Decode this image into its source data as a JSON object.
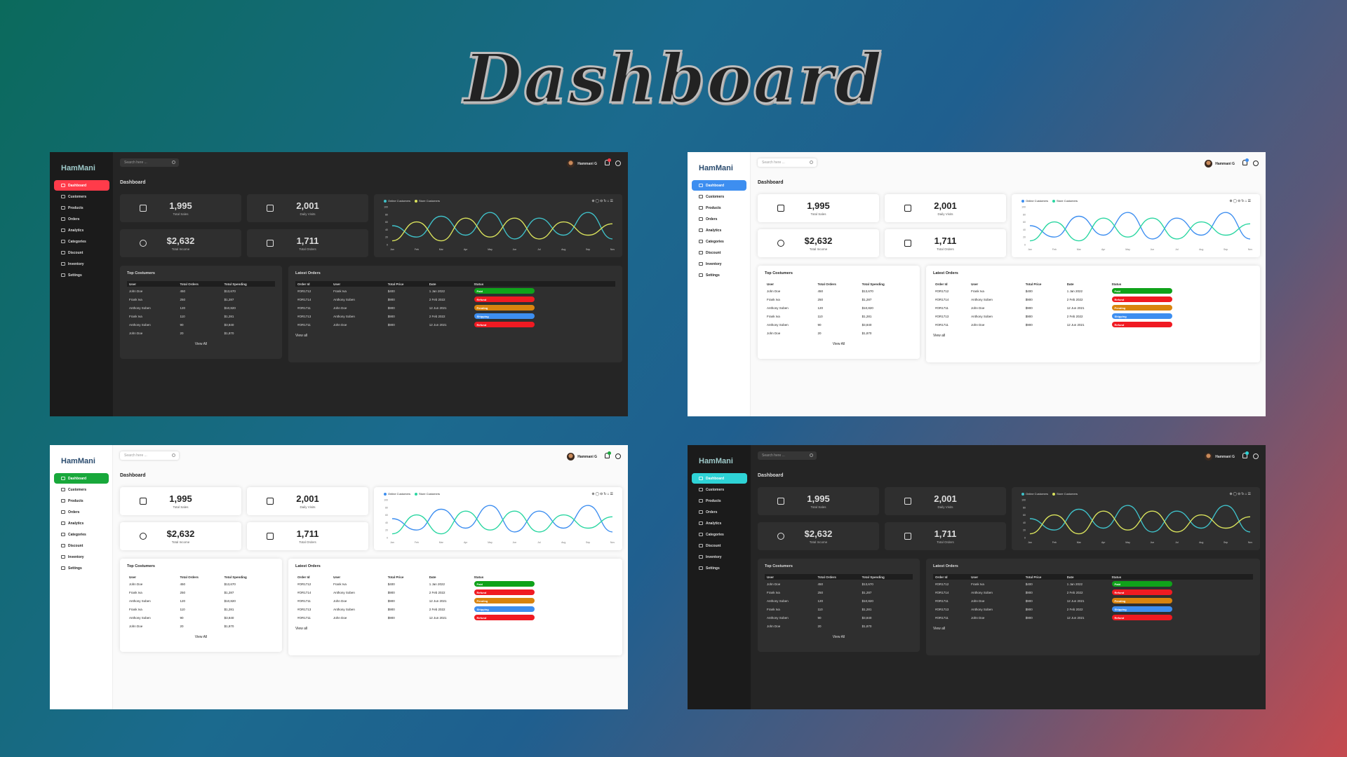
{
  "title": "Dashboard",
  "app": {
    "logo": "HamMani",
    "search_placeholder": "Search here ...",
    "user": "Hammani G",
    "page_title": "Dashboard",
    "nav": [
      "Dashboard",
      "Customers",
      "Products",
      "Orders",
      "Analytics",
      "Categories",
      "Discount",
      "Inventory",
      "Settings"
    ],
    "stats": [
      {
        "value": "1,995",
        "label": "Total Sales",
        "icon": "shopping-bag-icon"
      },
      {
        "value": "2,001",
        "label": "Daily Visits",
        "icon": "cart-icon"
      },
      {
        "value": "$2,632",
        "label": "Total Income",
        "icon": "dollar-icon"
      },
      {
        "value": "1,711",
        "label": "Total Orders",
        "icon": "receipt-icon"
      }
    ],
    "chart_legend": [
      "Online Customers",
      "Store Customers"
    ],
    "top_customers": {
      "title": "Top Costumers",
      "columns": [
        "User",
        "Total Orders",
        "Total Spending"
      ],
      "rows": [
        [
          "John Doe",
          "450",
          "$13,670"
        ],
        [
          "Frank Iva",
          "250",
          "$1,287"
        ],
        [
          "Anthony Soben",
          "120",
          "$10,820"
        ],
        [
          "Frank Iva",
          "110",
          "$1,281"
        ],
        [
          "Anthony Soben",
          "90",
          "$3,840"
        ],
        [
          "John Doe",
          "20",
          "$1,870"
        ]
      ],
      "view_all": "View All"
    },
    "latest_orders": {
      "title": "Latest Orders",
      "columns": [
        "Order Id",
        "User",
        "Total Price",
        "Date",
        "Status"
      ],
      "rows": [
        [
          "#OR1712",
          "Frank Iva",
          "$400",
          "1 Jan 2022",
          "Paid"
        ],
        [
          "#OR1714",
          "Anthony Soben",
          "$900",
          "2 Feb 2022",
          "Refund"
        ],
        [
          "#OR1711",
          "John Doe",
          "$900",
          "12 Jun 2021",
          "Pending"
        ],
        [
          "#OR1713",
          "Anthony Soben",
          "$900",
          "2 Feb 2022",
          "Shipping"
        ],
        [
          "#OR1711",
          "John Doe",
          "$900",
          "12 Jun 2021",
          "Refund"
        ]
      ],
      "view_all": "View all"
    }
  },
  "themes": [
    {
      "mode": "dark",
      "accent": "#ff3b4a",
      "line1": "#3fc1c9",
      "line2": "#d9e25c"
    },
    {
      "mode": "light",
      "accent": "#3d8ef0",
      "line1": "#3d8ef0",
      "line2": "#2ad6a1"
    },
    {
      "mode": "light",
      "accent": "#18a83b",
      "line1": "#3d8ef0",
      "line2": "#2ad6a1"
    },
    {
      "mode": "dark",
      "accent": "#2ed3d6",
      "line1": "#3fc1c9",
      "line2": "#d9e25c"
    }
  ],
  "status_colors": {
    "Paid": "#0fa21a",
    "Refund": "#f01a22",
    "Pending": "#d9840e",
    "Shipping": "#3d8ef0"
  },
  "chart_data": {
    "type": "line",
    "x": [
      "Jan",
      "Feb",
      "Mar",
      "Apr",
      "May",
      "Jun",
      "Jul",
      "Aug",
      "Sep",
      "Nov"
    ],
    "y_ticks": [
      0,
      20,
      40,
      60,
      80,
      100
    ],
    "series": [
      {
        "name": "Online Customers",
        "values": [
          50,
          20,
          75,
          25,
          85,
          15,
          70,
          25,
          85,
          15
        ]
      },
      {
        "name": "Store Customers",
        "values": [
          10,
          60,
          10,
          70,
          20,
          70,
          15,
          60,
          25,
          55
        ]
      }
    ]
  }
}
